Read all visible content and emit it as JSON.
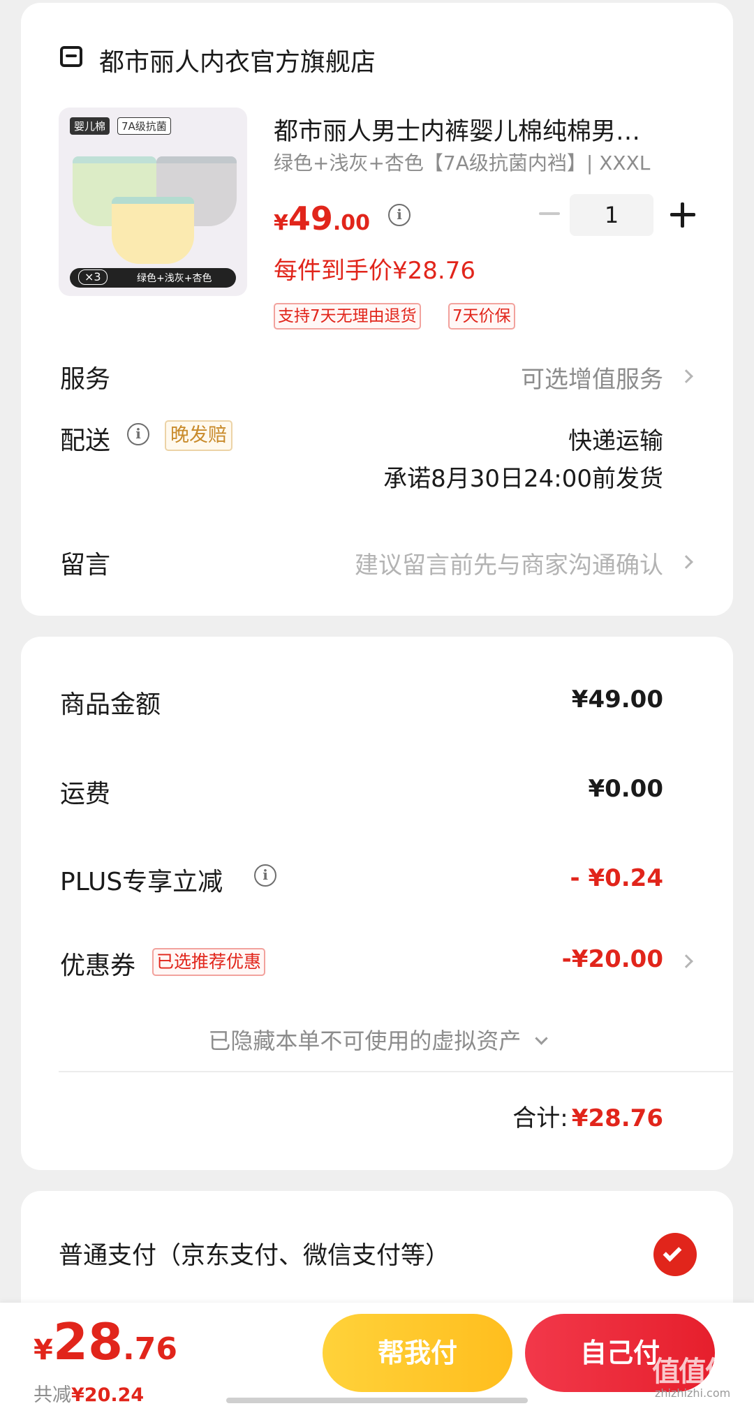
{
  "store": {
    "name": "都市丽人内衣官方旗舰店",
    "icon": "store-icon"
  },
  "product": {
    "image_badge_1": "婴儿棉",
    "image_badge_2": "7A级抗菌",
    "image_count": "×3",
    "image_colors": "绿色+浅灰+杏色",
    "title": "都市丽人男士内裤婴儿棉纯棉男…",
    "spec": "绿色+浅灰+杏色【7A级抗菌内裆】| XXXL",
    "price_symbol": "¥",
    "price_int": "49",
    "price_dec": ".00",
    "unit_price": "每件到手价¥28.76",
    "quantity": "1",
    "tag_return": "支持7天无理由退货",
    "tag_price_protect": "7天价保"
  },
  "rows": {
    "service_label": "服务",
    "service_value": "可选增值服务",
    "delivery_label": "配送",
    "delivery_badge": "晚发赔",
    "delivery_method": "快递运输",
    "delivery_promise": "承诺8月30日24:00前发货",
    "message_label": "留言",
    "message_placeholder": "建议留言前先与商家沟通确认"
  },
  "summary": {
    "goods_label": "商品金额",
    "goods_value": "¥49.00",
    "shipping_label": "运费",
    "shipping_value": "¥0.00",
    "plus_label": "PLUS专享立减",
    "plus_value": "- ¥0.24",
    "coupon_label": "优惠券",
    "coupon_badge": "已选推荐优惠",
    "coupon_value": "-¥20.00",
    "hidden_assets": "已隐藏本单不可使用的虚拟资产",
    "total_label": "合计:",
    "total_value": "¥28.76"
  },
  "payment": {
    "method": "普通支付（京东支付、微信支付等）",
    "selected": true
  },
  "bottom_bar": {
    "price_symbol": "¥",
    "price_int": "28",
    "price_dec": ".76",
    "saved_prefix": "共减",
    "saved_value": "¥20.24",
    "help_pay": "帮我付",
    "self_pay": "自己付",
    "watermark": "值值值",
    "watermark_url": "zhizhizhi.com"
  },
  "colors": {
    "accent_red": "#e1251b",
    "help_pay_yellow": "#ffc82c",
    "self_pay_red": "#ee2a3a",
    "badge_gold": "#c88a2a"
  }
}
